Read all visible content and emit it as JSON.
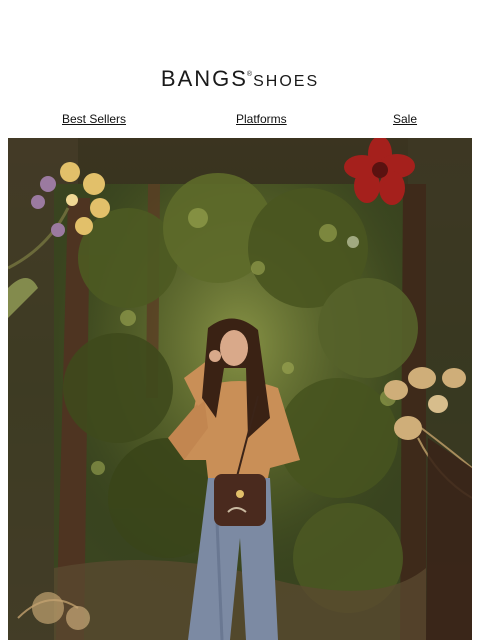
{
  "header": {
    "logo": {
      "brand": "BANGS",
      "mark": "®",
      "sub": "SHOES"
    }
  },
  "nav": {
    "items": [
      {
        "label": "Best Sellers"
      },
      {
        "label": "Platforms"
      },
      {
        "label": "Sale"
      }
    ]
  },
  "hero": {
    "image_name": "hero-photo",
    "colors": {
      "forest_dark": "#2c3518",
      "forest_mid": "#4f5a26",
      "leaf_light": "#8e9a45",
      "bark": "#5a3a22",
      "sweater": "#c98f57",
      "jeans": "#7c8aa3",
      "hair": "#3a2214",
      "bag": "#4a2a1e",
      "flower_red": "#a5201c",
      "flower_yellow": "#e2c06a",
      "flower_violet": "#9b7aa0",
      "dried_leaf": "#cfae79"
    }
  }
}
